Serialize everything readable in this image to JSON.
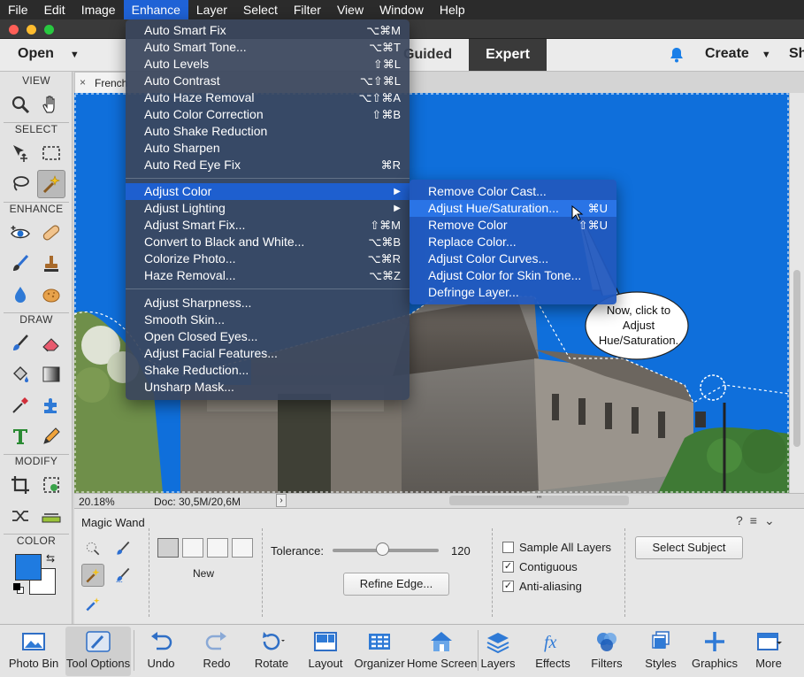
{
  "menubar": {
    "items": [
      "File",
      "Edit",
      "Image",
      "Enhance",
      "Layer",
      "Select",
      "Filter",
      "View",
      "Window",
      "Help"
    ],
    "active": "Enhance"
  },
  "header": {
    "open_label": "Open",
    "guided_label": "Guided",
    "expert_label": "Expert",
    "create_label": "Create",
    "share_label": "Sh"
  },
  "toolbox": {
    "sections": {
      "view": "VIEW",
      "select": "SELECT",
      "enhance": "ENHANCE",
      "draw": "DRAW",
      "modify": "MODIFY",
      "color": "COLOR"
    }
  },
  "document": {
    "tab_name": "French"
  },
  "status": {
    "zoom": "20.18%",
    "doc_size": "Doc: 30,5M/20,6M",
    "scroll_grip": "'''"
  },
  "enhance_menu": {
    "items": [
      {
        "label": "Auto Smart Fix",
        "shortcut": "⌥⌘M"
      },
      {
        "label": "Auto Smart Tone...",
        "shortcut": "⌥⌘T"
      },
      {
        "label": "Auto Levels",
        "shortcut": "⇧⌘L"
      },
      {
        "label": "Auto Contrast",
        "shortcut": "⌥⇧⌘L"
      },
      {
        "label": "Auto Haze Removal",
        "shortcut": "⌥⇧⌘A"
      },
      {
        "label": "Auto Color Correction",
        "shortcut": "⇧⌘B"
      },
      {
        "label": "Auto Shake Reduction",
        "shortcut": ""
      },
      {
        "label": "Auto Sharpen",
        "shortcut": ""
      },
      {
        "label": "Auto Red Eye Fix",
        "shortcut": "⌘R"
      },
      {
        "label": "Adjust Color",
        "shortcut": "▶"
      },
      {
        "label": "Adjust Lighting",
        "shortcut": "▶"
      },
      {
        "label": "Adjust Smart Fix...",
        "shortcut": "⇧⌘M"
      },
      {
        "label": "Convert to Black and White...",
        "shortcut": "⌥⌘B"
      },
      {
        "label": "Colorize Photo...",
        "shortcut": "⌥⌘R"
      },
      {
        "label": "Haze Removal...",
        "shortcut": "⌥⌘Z"
      },
      {
        "label": "Adjust Sharpness...",
        "shortcut": ""
      },
      {
        "label": "Smooth Skin...",
        "shortcut": ""
      },
      {
        "label": "Open Closed Eyes...",
        "shortcut": ""
      },
      {
        "label": "Adjust Facial Features...",
        "shortcut": ""
      },
      {
        "label": "Shake Reduction...",
        "shortcut": ""
      },
      {
        "label": "Unsharp Mask...",
        "shortcut": ""
      }
    ]
  },
  "adjust_color_menu": {
    "items": [
      {
        "label": "Remove Color Cast...",
        "shortcut": ""
      },
      {
        "label": "Adjust Hue/Saturation...",
        "shortcut": "⌘U"
      },
      {
        "label": "Remove Color",
        "shortcut": "⇧⌘U"
      },
      {
        "label": "Replace Color...",
        "shortcut": ""
      },
      {
        "label": "Adjust Color Curves...",
        "shortcut": ""
      },
      {
        "label": "Adjust Color for Skin Tone...",
        "shortcut": ""
      },
      {
        "label": "Defringe Layer...",
        "shortcut": ""
      }
    ]
  },
  "callout": {
    "line1": "Now, click to",
    "line2": "Adjust",
    "line3": "Hue/Saturation."
  },
  "tool_options": {
    "tool_name": "Magic Wand",
    "new_label": "New",
    "tolerance_label": "Tolerance:",
    "tolerance_value": "120",
    "tolerance_fraction": 0.47,
    "refine_edge": "Refine Edge...",
    "sample_all_layers": {
      "label": "Sample All Layers",
      "checked": false
    },
    "contiguous": {
      "label": "Contiguous",
      "checked": true
    },
    "anti_aliasing": {
      "label": "Anti-aliasing",
      "checked": true
    },
    "select_subject": "Select Subject"
  },
  "taskbar": {
    "items": [
      "Photo Bin",
      "Tool Options",
      "Undo",
      "Redo",
      "Rotate",
      "Layout",
      "Organizer",
      "Home Screen",
      "Layers",
      "Effects",
      "Filters",
      "Styles",
      "Graphics",
      "More"
    ]
  },
  "colors": {
    "selection_sky": "#0f6fdb",
    "menu_highlight": "#1e5fcf",
    "accent": "#1f7be0"
  }
}
